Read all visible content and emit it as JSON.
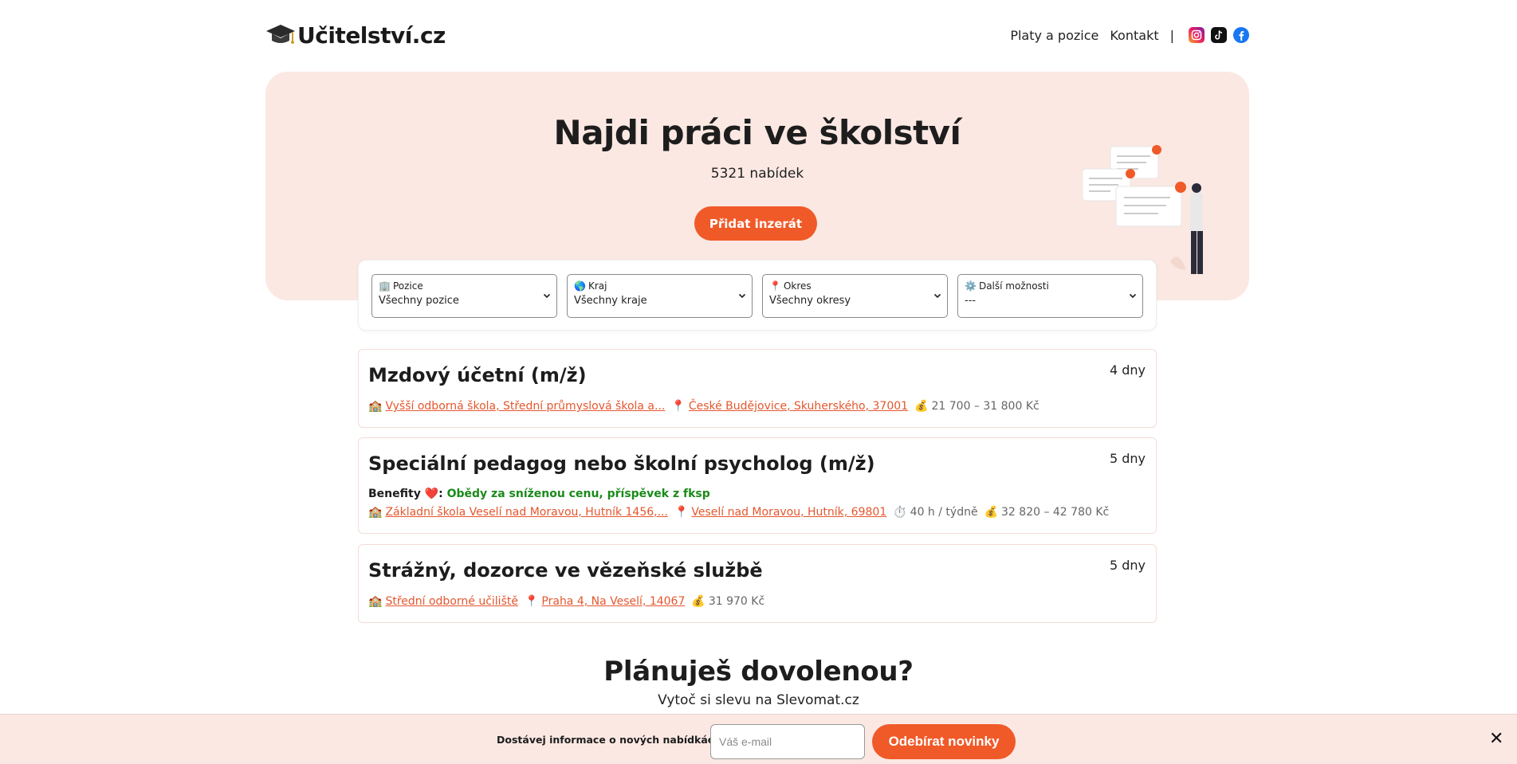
{
  "header": {
    "logo_text": "Učitelství.cz",
    "nav": {
      "salaries": "Platy a pozice",
      "contact": "Kontakt",
      "separator": "|"
    },
    "social": [
      "instagram-icon",
      "tiktok-icon",
      "facebook-icon"
    ]
  },
  "hero": {
    "title": "Najdi práci ve školství",
    "count": "5321 nabídek",
    "add_button": "Přidat inzerát"
  },
  "filters": [
    {
      "icon": "🏢",
      "label": "Pozice",
      "value": "Všechny pozice"
    },
    {
      "icon": "🌎",
      "label": "Kraj",
      "value": "Všechny kraje"
    },
    {
      "icon": "📍",
      "label": "Okres",
      "value": "Všechny okresy"
    },
    {
      "icon": "⚙️",
      "label": "Další možnosti",
      "value": "---"
    }
  ],
  "jobs": [
    {
      "title": "Mzdový účetní (m/ž)",
      "age": "4 dny",
      "school": "Vyšší odborná škola, Střední průmyslová škola a...",
      "location": "České Budějovice, Skuherského, 37001",
      "salary": "21 700 – 31 800 Kč"
    },
    {
      "title": "Speciální pedagog nebo školní psycholog (m/ž)",
      "age": "5 dny",
      "benefits_label": "Benefity ❤️:",
      "benefits": "Obědy za sníženou cenu, příspěvek z fksp",
      "school": "Základní škola Veselí nad Moravou, Hutník 1456,...",
      "location": "Veselí nad Moravou, Hutník, 69801",
      "hours": "40 h / týdně",
      "salary": "32 820 – 42 780 Kč"
    },
    {
      "title": "Strážný, dozorce ve vězeňské službě",
      "age": "5 dny",
      "school": "Střední odborné učiliště",
      "location": "Praha 4, Na Veselí, 14067",
      "salary": "31 970 Kč"
    }
  ],
  "promo": {
    "title": "Plánuješ dovolenou?",
    "subtitle": "Vytoč si slevu na Slevomat.cz"
  },
  "newsletter": {
    "text": "Dostávej informace o nových nabídkách práce",
    "placeholder": "Váš e-mail",
    "button": "Odebírat novinky",
    "close": "✕"
  },
  "colors": {
    "accent": "#f05a28",
    "hero_bg": "#fbe8e3",
    "link": "#e4572e",
    "benefit": "#1a8a1a"
  }
}
